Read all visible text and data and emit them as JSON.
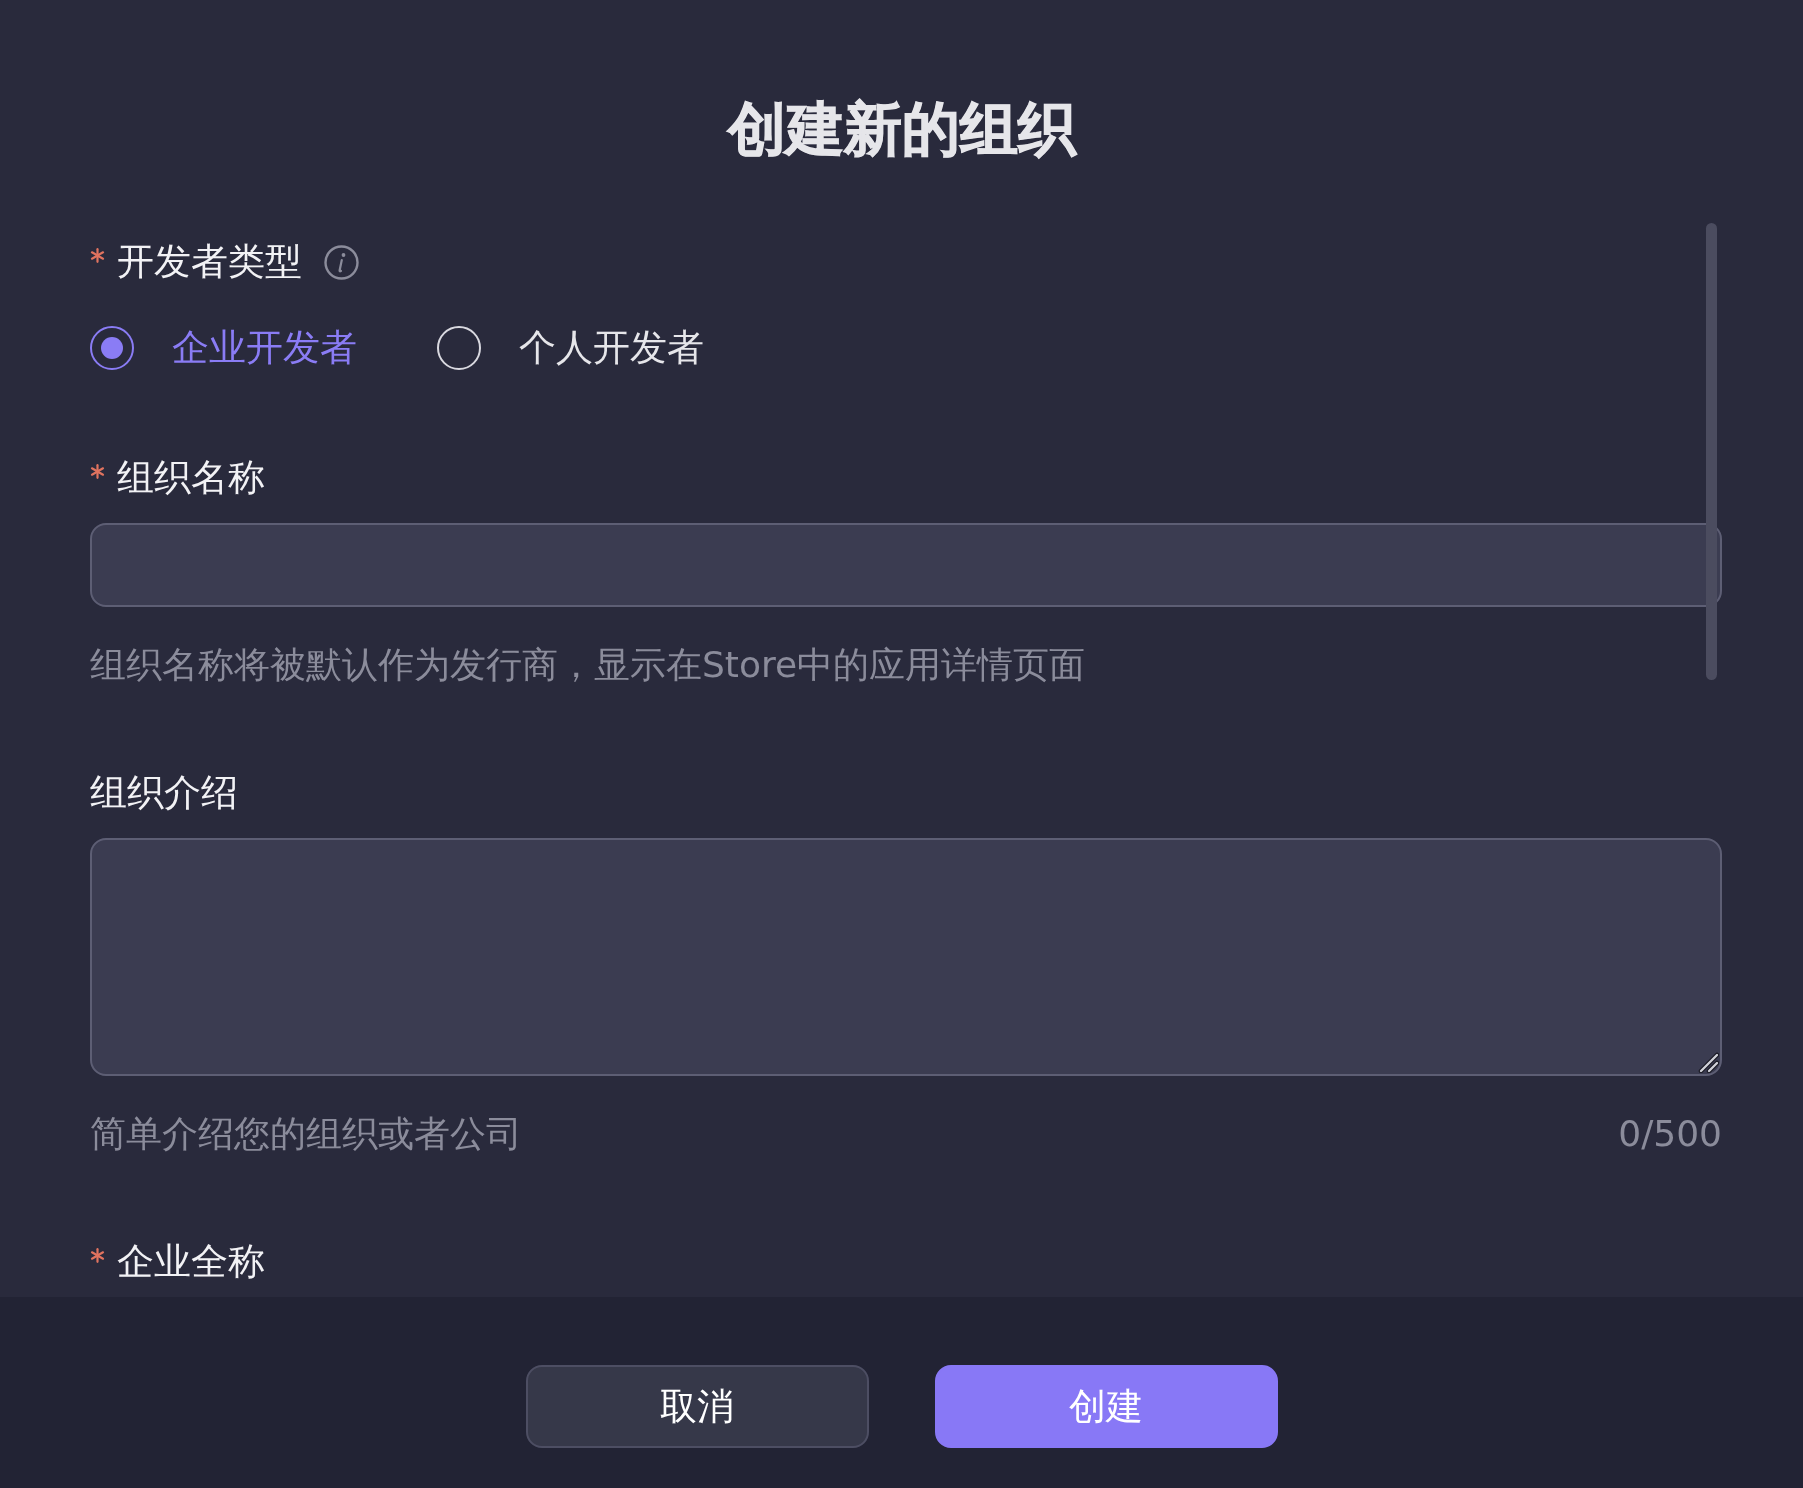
{
  "title": "创建新的组织",
  "fields": [
    {
      "kind": "radio",
      "label": "开发者类型",
      "required": true,
      "info": true,
      "options": [
        {
          "label": "企业开发者",
          "selected": true
        },
        {
          "label": "个人开发者",
          "selected": false
        }
      ]
    },
    {
      "kind": "input",
      "label": "组织名称",
      "required": true,
      "info": false,
      "hint": "组织名称将被默认作为发行商，显示在Store中的应用详情页面"
    },
    {
      "kind": "textarea",
      "label": "组织介绍",
      "required": false,
      "info": false,
      "hint": "简单介绍您的组织或者公司",
      "counter": "0/500"
    },
    {
      "kind": "label",
      "label": "企业全称",
      "required": true,
      "info": false
    }
  ],
  "buttons": [
    {
      "label": "取消",
      "kind": "secondary"
    },
    {
      "label": "创建",
      "kind": "primary"
    }
  ]
}
